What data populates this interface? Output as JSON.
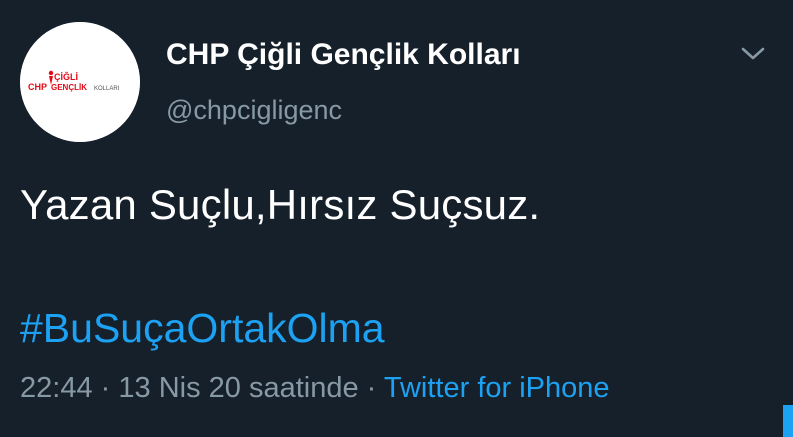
{
  "tweet": {
    "display_name": "CHP Çiğli Gençlik Kolları",
    "handle": "@chpcigligenc",
    "text": "Yazan Suçlu,Hırsız Suçsuz.",
    "hashtag": "#BuSuçaOrtakOlma",
    "time": "22:44",
    "separator": "·",
    "date": "13 Nis 20 saatinde",
    "source": "Twitter for iPhone"
  },
  "avatar": {
    "logo_line1": "ÇİĞLİ",
    "logo_chp": "CHP",
    "logo_line2": "GENÇLİK",
    "logo_line2_suffix": "KOLLARI"
  },
  "icons": {
    "caret": "chevron-down-icon"
  },
  "colors": {
    "background": "#15202b",
    "primary_text": "#ffffff",
    "secondary_text": "#8899a6",
    "link": "#1da1f2",
    "brand_red": "#e30a17"
  }
}
